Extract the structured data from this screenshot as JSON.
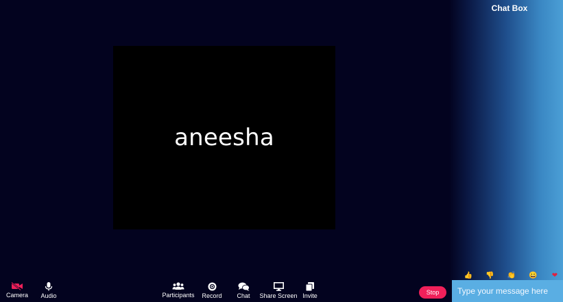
{
  "video": {
    "participant_name": "aneesha"
  },
  "chat": {
    "title": "Chat Box",
    "input_placeholder": "Type your message here",
    "reactions": [
      {
        "icon": "thumbs-up-icon",
        "glyph": "👍"
      },
      {
        "icon": "thumbs-down-icon",
        "glyph": "👎"
      },
      {
        "icon": "clap-icon",
        "glyph": "👏"
      },
      {
        "icon": "smile-icon",
        "glyph": "😀"
      },
      {
        "icon": "heart-icon",
        "glyph": "❤"
      }
    ]
  },
  "toolbar": {
    "camera": {
      "label": "Camera",
      "icon": "camera-off-icon",
      "color": "#f0205a"
    },
    "audio": {
      "label": "Audio",
      "icon": "microphone-icon"
    },
    "participants": {
      "label": "Participants",
      "icon": "participants-icon"
    },
    "record": {
      "label": "Record",
      "icon": "record-icon"
    },
    "chat": {
      "label": "Chat",
      "icon": "chat-icon"
    },
    "share_screen": {
      "label": "Share Screen",
      "icon": "monitor-icon"
    },
    "invite": {
      "label": "Invite",
      "icon": "invite-icon"
    },
    "stop_label": "Stop"
  },
  "colors": {
    "background": "#03031f",
    "accent": "#f0205a",
    "chat_input": "#5aaee3"
  }
}
